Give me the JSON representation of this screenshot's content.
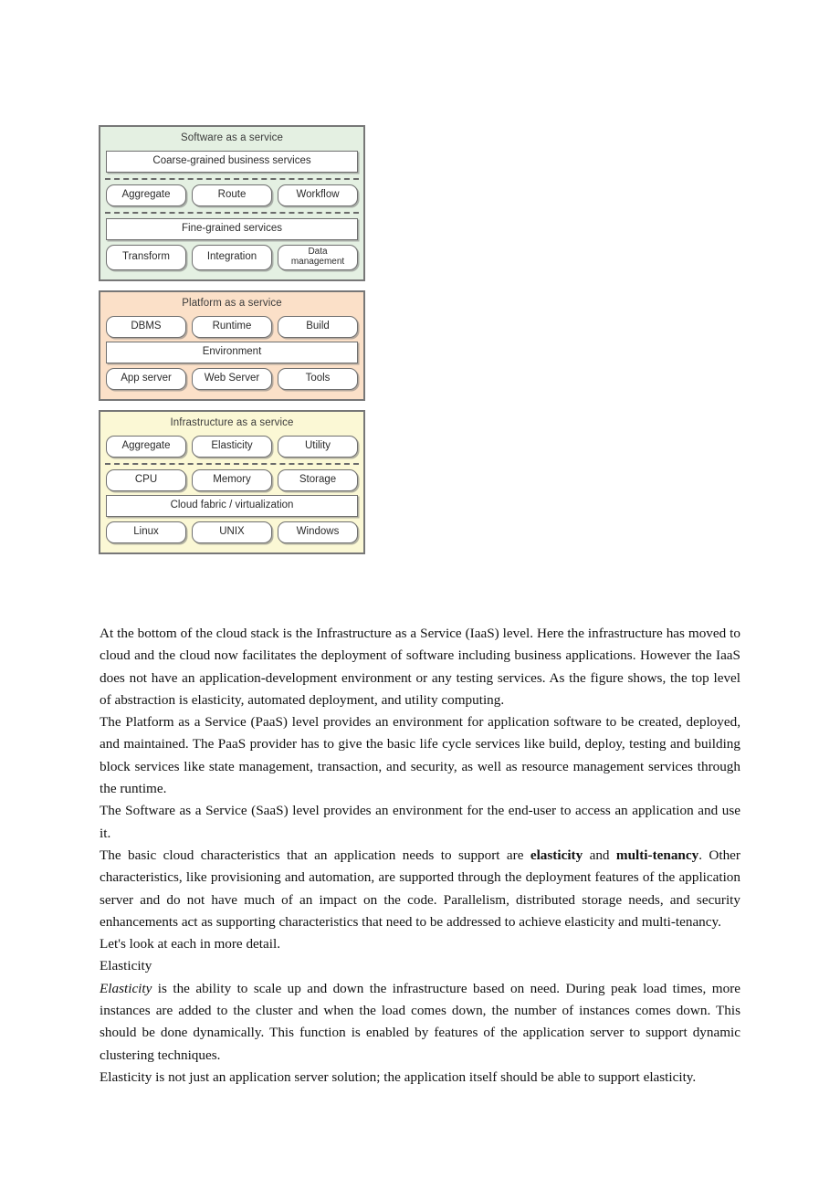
{
  "figure": {
    "name": "cloud-stack-diagram",
    "blocks": [
      {
        "id": "saas",
        "title": "Software as a service",
        "bg": "#e4f0e2",
        "rows": [
          {
            "type": "wide",
            "items": [
              "Coarse-grained business services"
            ]
          },
          {
            "type": "divider"
          },
          {
            "type": "pills",
            "items": [
              "Aggregate",
              "Route",
              "Workflow"
            ]
          },
          {
            "type": "divider"
          },
          {
            "type": "wide",
            "items": [
              "Fine-grained services"
            ]
          },
          {
            "type": "pills",
            "items": [
              "Transform",
              "Integration",
              "Data management"
            ]
          }
        ]
      },
      {
        "id": "paas",
        "title": "Platform as a service",
        "bg": "#fbe0c8",
        "rows": [
          {
            "type": "pills",
            "items": [
              "DBMS",
              "Runtime",
              "Build"
            ]
          },
          {
            "type": "wide",
            "items": [
              "Environment"
            ]
          },
          {
            "type": "pills",
            "items": [
              "App server",
              "Web Server",
              "Tools"
            ]
          }
        ]
      },
      {
        "id": "iaas",
        "title": "Infrastructure as a service",
        "bg": "#fbf8d5",
        "rows": [
          {
            "type": "pills",
            "items": [
              "Aggregate",
              "Elasticity",
              "Utility"
            ]
          },
          {
            "type": "divider"
          },
          {
            "type": "pills",
            "items": [
              "CPU",
              "Memory",
              "Storage"
            ]
          },
          {
            "type": "wide",
            "items": [
              "Cloud fabric / virtualization"
            ]
          },
          {
            "type": "pills",
            "items": [
              "Linux",
              "UNIX",
              "Windows"
            ]
          }
        ]
      }
    ]
  },
  "body": {
    "paragraphs": [
      {
        "id": "p-iaas",
        "html": "At the bottom of the cloud stack is the Infrastructure as a Service (IaaS) level. Here the infrastructure has moved to cloud and the cloud now facilitates the deployment of software including business applications. However the IaaS does not have an application-development environment or any testing services. As the figure shows, the top level of abstraction is elasticity, automated deployment, and utility computing."
      },
      {
        "id": "p-paas",
        "html": "The Platform as a Service (PaaS) level provides an environment for application software to be created, deployed, and maintained. The PaaS provider has to give the basic life cycle services like build, deploy, testing and building block services like state management, transaction, and security, as well as resource management services through the runtime."
      },
      {
        "id": "p-saas",
        "html": "The Software as a Service (SaaS) level provides an environment for the end-user to access an application and use it."
      },
      {
        "id": "p-characteristics",
        "html": "The basic cloud characteristics that an application needs to support are <b>elasticity</b> and <b>multi-tenancy</b>. Other characteristics, like provisioning and automation, are supported through the deployment features of the application server and do not have much of an impact on the code. Parallelism, distributed storage needs, and security enhancements act as supporting characteristics that need to be addressed to achieve elasticity and multi-tenancy."
      },
      {
        "id": "p-lets-look",
        "html": "Let's look at each in more detail."
      },
      {
        "id": "p-heading-elasticity",
        "html": "Elasticity"
      },
      {
        "id": "p-elasticity-def",
        "html": "<i>Elasticity</i> is the ability to scale up and down the infrastructure based on need. During peak load times, more instances are added to the cluster and when the load comes down, the number of instances comes down. This should be done dynamically. This function is enabled by features of the application server to support dynamic clustering techniques."
      },
      {
        "id": "p-elasticity-note",
        "html": "Elasticity is not just an application server solution; the application itself should be able to support elasticity."
      }
    ]
  }
}
